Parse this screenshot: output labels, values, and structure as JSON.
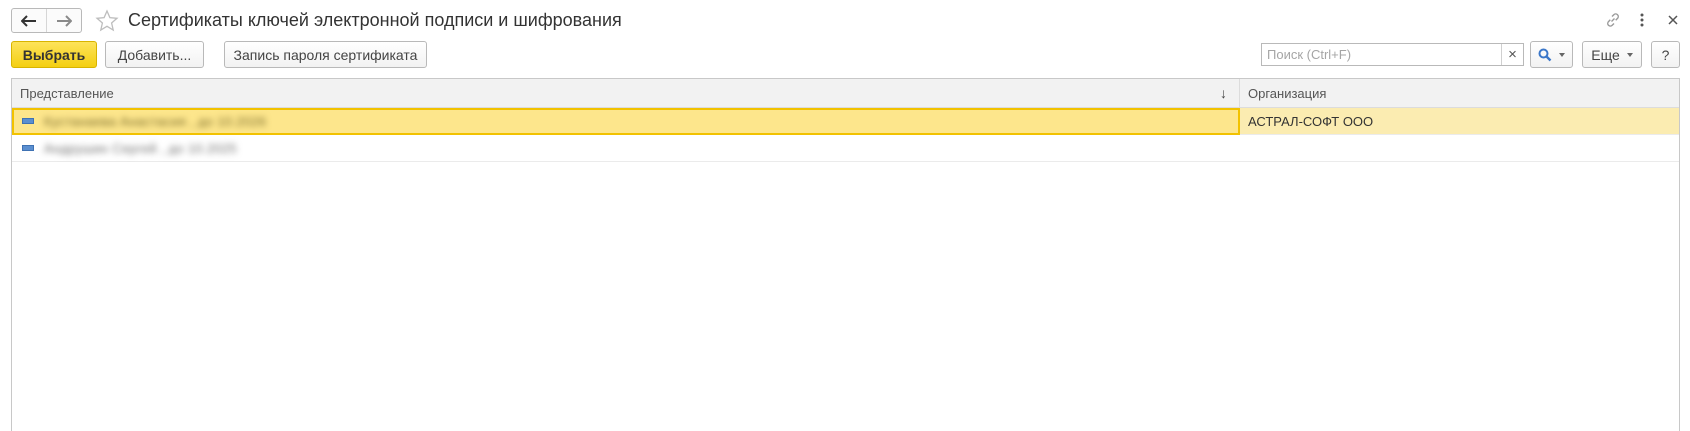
{
  "window": {
    "title": "Сертификаты ключей электронной подписи и шифрования",
    "icons": [
      "back-arrow-icon",
      "forward-arrow-icon",
      "star-icon",
      "link-icon",
      "more-vertical-icon",
      "close-icon"
    ]
  },
  "toolbar": {
    "select_label": "Выбрать",
    "add_label": "Добавить...",
    "password_label": "Запись пароля сертификата",
    "search_placeholder": "Поиск (Ctrl+F)",
    "clear_label": "×",
    "more_label": "Еще",
    "help_label": "?"
  },
  "table": {
    "columns": [
      "Представление",
      "Организация"
    ],
    "sort_indicator": "↓",
    "rows": [
      {
        "name": "Кустанаева Анастасия , до 10.2026",
        "organization": "АСТРАЛ-СОФТ ООО",
        "selected": true
      },
      {
        "name": "Андрушин Сергей , до 10.2025",
        "organization": "",
        "selected": false
      }
    ]
  },
  "colors": {
    "primary_button": "#f4cf12",
    "selected_row": "#fbecb1",
    "selected_cell_border": "#f2c200",
    "search_icon": "#3b77c9"
  }
}
